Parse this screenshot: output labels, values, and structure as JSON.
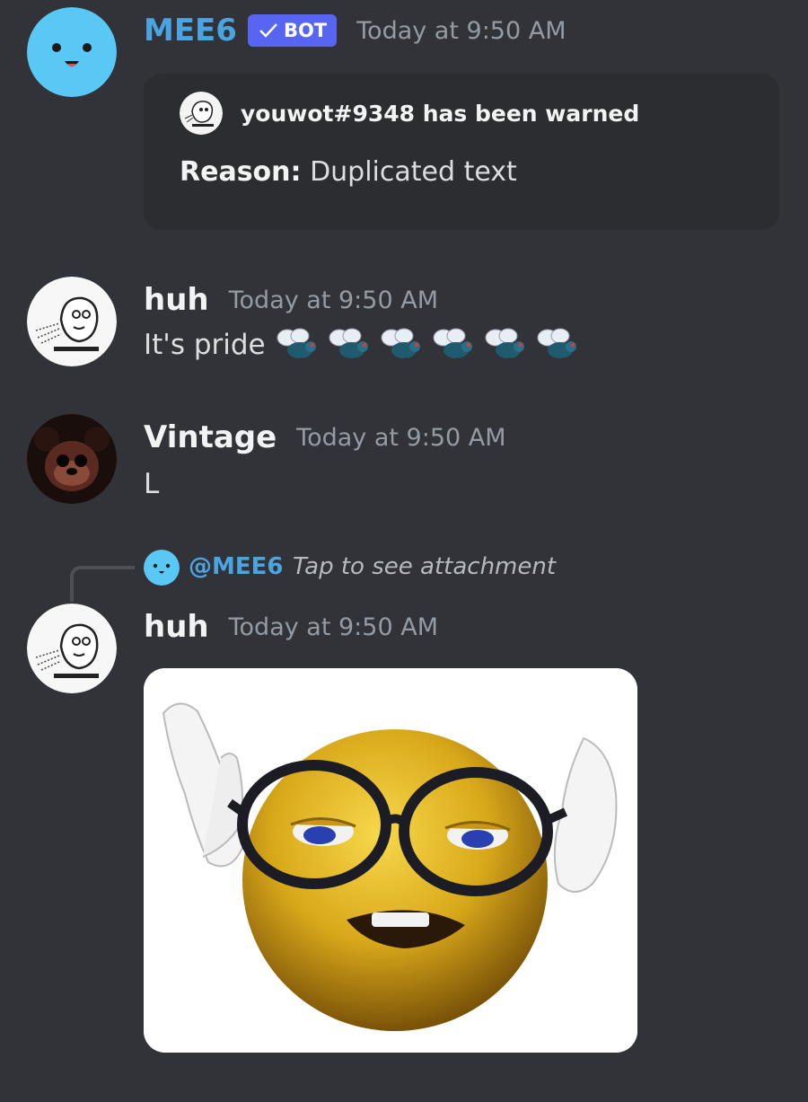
{
  "messages": [
    {
      "author": "MEE6",
      "badge": "BOT",
      "timestamp": "Today at 9:50 AM",
      "embed": {
        "author_text": "youwot#9348 has been warned",
        "reason_label": "Reason:",
        "reason_value": "Duplicated text"
      }
    },
    {
      "author": "huh",
      "timestamp": "Today at 9:50 AM",
      "text": "It's pride"
    },
    {
      "author": "Vintage",
      "timestamp": "Today at 9:50 AM",
      "text": "L"
    },
    {
      "author": "huh",
      "timestamp": "Today at 9:50 AM",
      "reply": {
        "mention": "@MEE6",
        "text": "Tap to see attachment"
      },
      "attachment": "image"
    }
  ],
  "colors": {
    "background": "#313338",
    "mention": "#4ba3e0",
    "bot_badge": "#5865f2",
    "embed_bg": "#2b2d31"
  },
  "icons": {
    "emoji": "fly-emoji",
    "verified": "checkmark-icon"
  }
}
